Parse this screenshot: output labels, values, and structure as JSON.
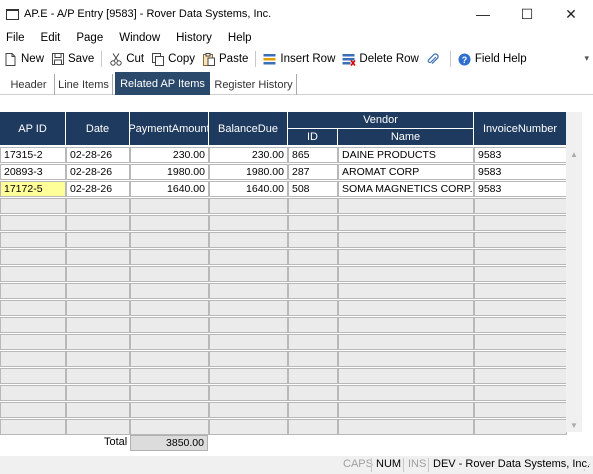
{
  "window": {
    "title": "AP.E - A/P Entry [9583] - Rover Data Systems, Inc.",
    "minimize_glyph": "—",
    "maximize_glyph": "☐",
    "close_glyph": "✕"
  },
  "menu": [
    {
      "label": "File"
    },
    {
      "label": "Edit"
    },
    {
      "label": "Page"
    },
    {
      "label": "Window"
    },
    {
      "label": "History"
    },
    {
      "label": "Help"
    }
  ],
  "toolbar": {
    "new_label": "New",
    "save_label": "Save",
    "cut_label": "Cut",
    "copy_label": "Copy",
    "paste_label": "Paste",
    "insert_row_label": "Insert Row",
    "delete_row_label": "Delete Row",
    "field_help_label": "Field Help"
  },
  "tabs": [
    {
      "label": "Header"
    },
    {
      "label": "Line Items"
    },
    {
      "label": "Related AP Items",
      "active": true
    },
    {
      "label": "Register History"
    }
  ],
  "grid": {
    "headers": {
      "ap_id": "AP ID",
      "date": "Date",
      "payment_amount": "PaymentAmount",
      "balance_due": "BalanceDue",
      "vendor": "Vendor",
      "vendor_id": "ID",
      "vendor_name": "Name",
      "invoice_number": "InvoiceNumber"
    },
    "rows": [
      {
        "ap_id": "17315-2",
        "date": "02-28-26",
        "payment": "230.00",
        "balance": "230.00",
        "vendor_id": "865",
        "vendor_name": "DAINE PRODUCTS",
        "invoice": "9583"
      },
      {
        "ap_id": "20893-3",
        "date": "02-28-26",
        "payment": "1980.00",
        "balance": "1980.00",
        "vendor_id": "287",
        "vendor_name": "AROMAT CORP",
        "invoice": "9583"
      },
      {
        "ap_id": "17172-5",
        "date": "02-28-26",
        "payment": "1640.00",
        "balance": "1640.00",
        "vendor_id": "508",
        "vendor_name": "SOMA MAGNETICS CORP.",
        "invoice": "9583"
      }
    ],
    "total_label": "Total",
    "total_value": "3850.00"
  },
  "status": {
    "caps": "CAPS",
    "num": "NUM",
    "ins": "INS",
    "connection": "DEV - Rover Data Systems, Inc."
  },
  "colors": {
    "header_bg": "#1f3a5f",
    "active_tab_bg": "#2b4a6b",
    "highlight_cell": "#ffff99",
    "empty_cell": "#ebebeb"
  }
}
